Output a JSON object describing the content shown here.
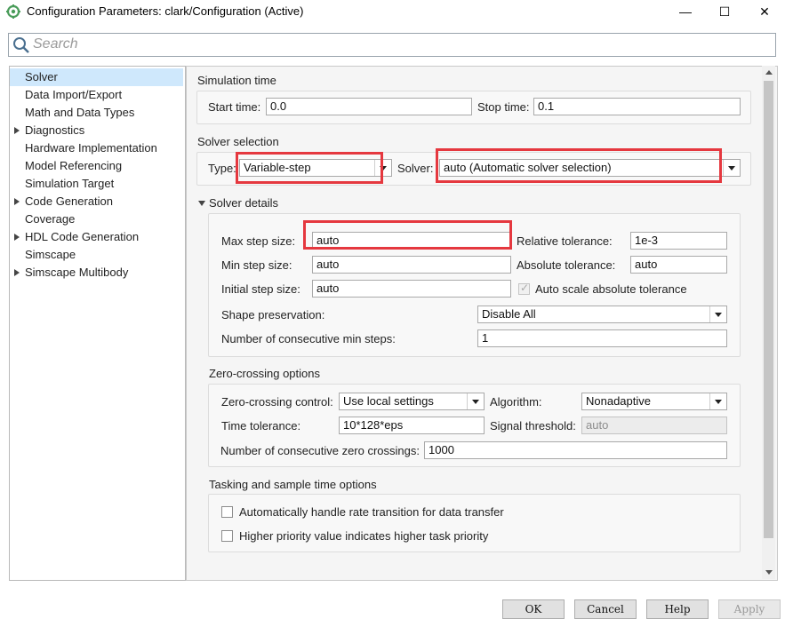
{
  "window": {
    "title": "Configuration Parameters: clark/Configuration (Active)",
    "controls": {
      "minimize": "—",
      "maximize": "☐",
      "close": "✕"
    }
  },
  "search": {
    "placeholder": "Search",
    "icon": "search-icon"
  },
  "tree": {
    "items": [
      {
        "label": "Solver",
        "expandable": false,
        "selected": true
      },
      {
        "label": "Data Import/Export",
        "expandable": false
      },
      {
        "label": "Math and Data Types",
        "expandable": false
      },
      {
        "label": "Diagnostics",
        "expandable": true
      },
      {
        "label": "Hardware Implementation",
        "expandable": false
      },
      {
        "label": "Model Referencing",
        "expandable": false
      },
      {
        "label": "Simulation Target",
        "expandable": false
      },
      {
        "label": "Code Generation",
        "expandable": true
      },
      {
        "label": "Coverage",
        "expandable": false
      },
      {
        "label": "HDL Code Generation",
        "expandable": true
      },
      {
        "label": "Simscape",
        "expandable": false
      },
      {
        "label": "Simscape Multibody",
        "expandable": true
      }
    ]
  },
  "simulation_time": {
    "title": "Simulation time",
    "start_label": "Start time:",
    "start_value": "0.0",
    "stop_label": "Stop time:",
    "stop_value": "0.1"
  },
  "solver_selection": {
    "title": "Solver selection",
    "type_label": "Type:",
    "type_value": "Variable-step",
    "solver_label": "Solver:",
    "solver_value": "auto (Automatic solver selection)"
  },
  "solver_details": {
    "title": "Solver details",
    "max_step_label": "Max step size:",
    "max_step_value": "auto",
    "min_step_label": "Min step size:",
    "min_step_value": "auto",
    "initial_step_label": "Initial step size:",
    "initial_step_value": "auto",
    "rel_tol_label": "Relative tolerance:",
    "rel_tol_value": "1e-3",
    "abs_tol_label": "Absolute tolerance:",
    "abs_tol_value": "auto",
    "auto_scale_label": "Auto scale absolute tolerance",
    "shape_label": "Shape preservation:",
    "shape_value": "Disable All",
    "consec_min_label": "Number of consecutive min steps:",
    "consec_min_value": "1"
  },
  "zero_crossing": {
    "title": "Zero-crossing options",
    "control_label": "Zero-crossing control:",
    "control_value": "Use local settings",
    "algorithm_label": "Algorithm:",
    "algorithm_value": "Nonadaptive",
    "time_tol_label": "Time tolerance:",
    "time_tol_value": "10*128*eps",
    "signal_threshold_label": "Signal threshold:",
    "signal_threshold_value": "auto",
    "consec_zc_label": "Number of consecutive zero crossings:",
    "consec_zc_value": "1000"
  },
  "tasking": {
    "title": "Tasking and sample time options",
    "rate_transition_label": "Automatically handle rate transition for data transfer",
    "priority_label": "Higher priority value indicates higher task priority"
  },
  "buttons": {
    "ok": "OK",
    "cancel": "Cancel",
    "help": "Help",
    "apply": "Apply"
  },
  "colors": {
    "highlight": "#e5383f",
    "selection": "#cfe8fc"
  }
}
